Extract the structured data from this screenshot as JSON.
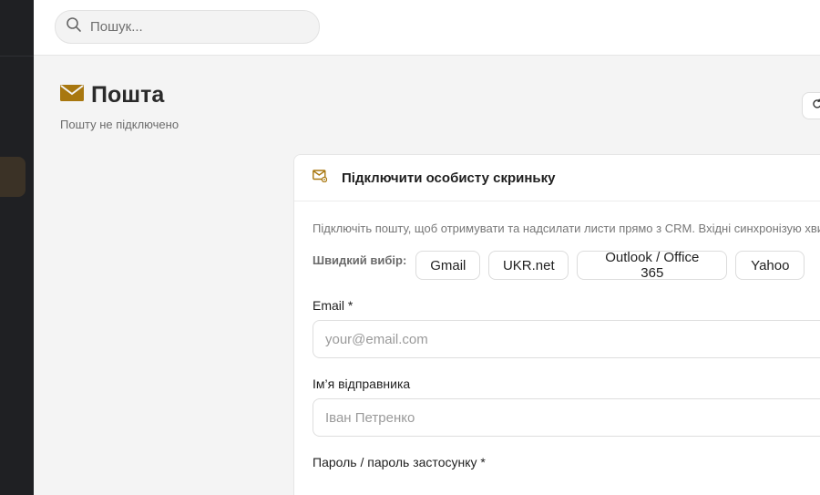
{
  "header": {
    "search_placeholder": "Пошук..."
  },
  "page": {
    "title": "Пошта",
    "subtitle": "Пошту не підключено"
  },
  "card": {
    "title": "Підключити особисту скриньку",
    "description": "Підключіть пошту, щоб отримувати та надсилати листи прямо з CRM. Вхідні синхронізую хвилин.",
    "quick_label": "Швидкий вибір:",
    "providers": [
      "Gmail",
      "UKR.net",
      "Outlook / Office 365",
      "Yahoo"
    ],
    "fields": {
      "email_label": "Email *",
      "email_placeholder": "your@email.com",
      "name_label": "Ім’я відправника",
      "name_placeholder": "Іван Петренко",
      "password_label": "Пароль / пароль застосунку *"
    }
  },
  "colors": {
    "accent": "#a8770f",
    "sidebar": "#1f2023"
  }
}
